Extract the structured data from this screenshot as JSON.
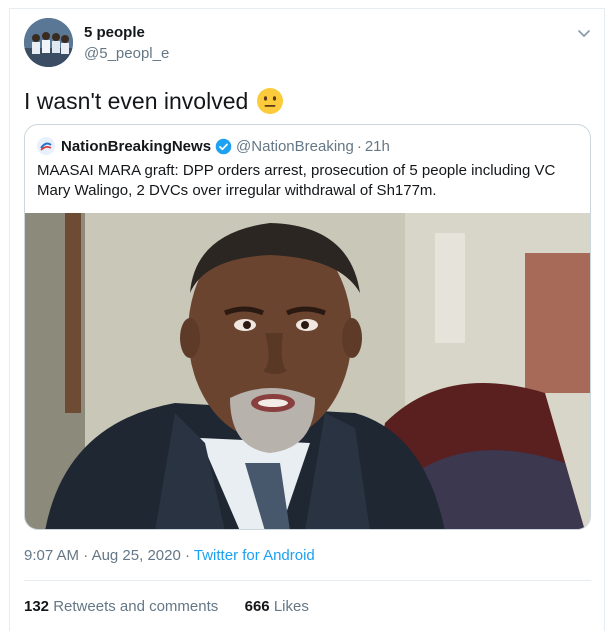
{
  "author": {
    "name": "5 people",
    "handle": "@5_peopl_e",
    "avatar_icon": "group-photo-avatar"
  },
  "tweet": {
    "text": "I wasn't even involved",
    "emoji_icon": "neutral-face-emoji"
  },
  "quoted_tweet": {
    "name": "NationBreakingNews",
    "handle": "@NationBreaking",
    "separator": "·",
    "time": "21h",
    "body": "MAASAI MARA graft: DPP orders arrest, prosecution of 5 people including VC Mary Walingo, 2 DVCs over irregular withdrawal of Sh177m.",
    "photo_icon": "man-portrait-photo"
  },
  "meta": {
    "time": "9:07 AM",
    "separator1": "·",
    "date": "Aug 25, 2020",
    "separator2": "·",
    "source": "Twitter for Android"
  },
  "stats": {
    "retweets_count": "132",
    "retweets_label": "Retweets and comments",
    "likes_count": "666",
    "likes_label": "Likes"
  },
  "colors": {
    "link": "#1da1f2",
    "secondary_text": "#657786",
    "border": "#ccd6dd"
  }
}
